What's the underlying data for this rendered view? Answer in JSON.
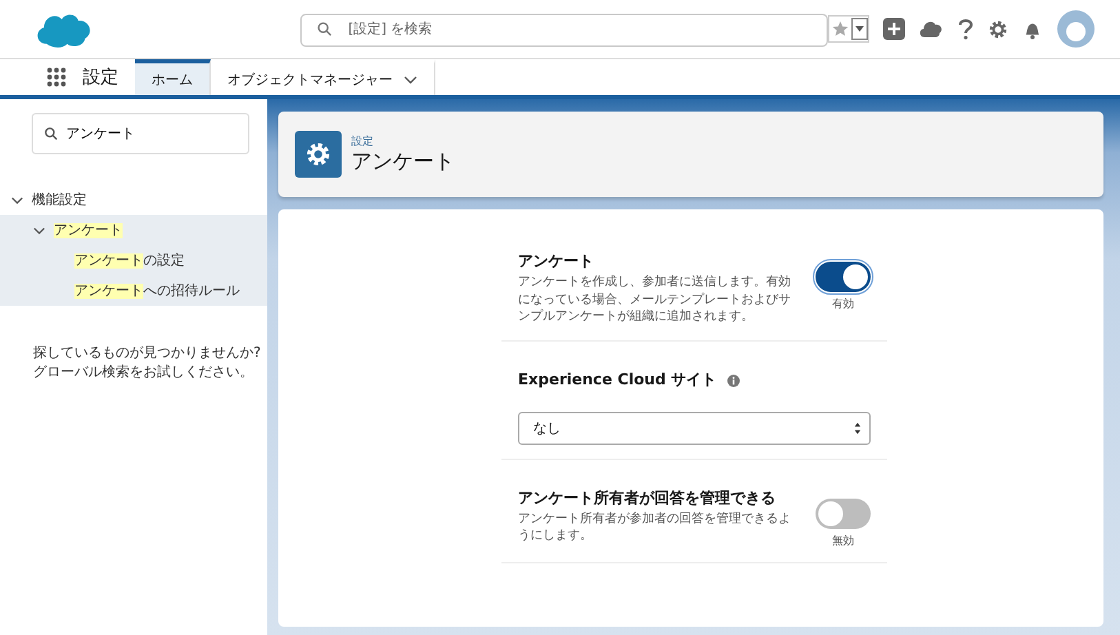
{
  "header": {
    "search": {
      "placeholder": "[設定] を検索"
    }
  },
  "nav": {
    "app_name": "設定",
    "tabs": [
      {
        "label": "ホーム",
        "selected": true,
        "dropdown": false
      },
      {
        "label": "オブジェクトマネージャー",
        "selected": false,
        "dropdown": true
      }
    ]
  },
  "sidebar": {
    "search": {
      "value": "アンケート"
    },
    "tree": [
      {
        "label": "機能設定",
        "expanded": true,
        "children": [
          {
            "highlight": "アンケート",
            "expanded": true,
            "children": [
              {
                "highlight": "アンケート",
                "label": "の設定"
              },
              {
                "highlight": "アンケート",
                "label": "への招待ルール"
              }
            ]
          }
        ]
      }
    ],
    "help": "探しているものが見つかりませんか?\nグローバル検索をお試しください。"
  },
  "page_header": {
    "breadcrumb": "設定",
    "title": "アンケート"
  },
  "settings": [
    {
      "kind": "toggle",
      "title": "アンケート",
      "description": "アンケートを作成し、参加者に送信します。有効になっている場合、メールテンプレートおよびサンプルアンケートが組織に追加されます。",
      "on": true,
      "state_label": "有効"
    },
    {
      "kind": "select",
      "title": "Experience Cloud サイト",
      "value": "なし"
    },
    {
      "kind": "toggle",
      "title": "アンケート所有者が回答を管理できる",
      "description": "アンケート所有者が参加者の回答を管理できるようにします。",
      "on": false,
      "state_label": "無効"
    }
  ]
}
